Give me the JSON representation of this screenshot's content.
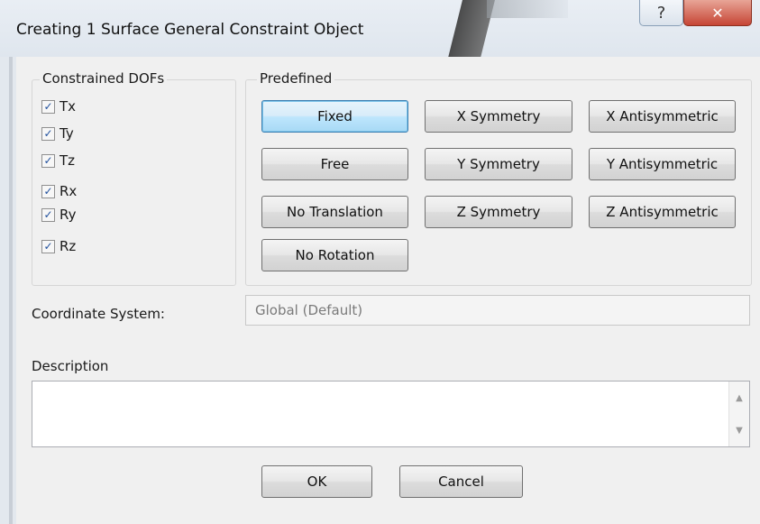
{
  "window": {
    "title": "Creating 1 Surface General Constraint Object",
    "help_glyph": "?",
    "close_glyph": "✕"
  },
  "constrained_dofs": {
    "legend": "Constrained DOFs",
    "items": [
      {
        "label": "Tx",
        "checked": true
      },
      {
        "label": "Ty",
        "checked": true
      },
      {
        "label": "Tz",
        "checked": true
      },
      {
        "label": "Rx",
        "checked": true
      },
      {
        "label": "Ry",
        "checked": true
      },
      {
        "label": "Rz",
        "checked": true
      }
    ]
  },
  "predefined": {
    "legend": "Predefined",
    "buttons": {
      "fixed": "Fixed",
      "free": "Free",
      "no_translation": "No Translation",
      "no_rotation": "No Rotation",
      "x_symmetry": "X Symmetry",
      "y_symmetry": "Y Symmetry",
      "z_symmetry": "Z Symmetry",
      "x_antisymmetric": "X Antisymmetric",
      "y_antisymmetric": "Y Antisymmetric",
      "z_antisymmetric": "Z Antisymmetric"
    }
  },
  "coordinate_system": {
    "label": "Coordinate System:",
    "value": "Global (Default)"
  },
  "description": {
    "label": "Description",
    "value": ""
  },
  "footer": {
    "ok_label": "OK",
    "cancel_label": "Cancel"
  },
  "colors": {
    "dialog_bg": "#f0f0f0",
    "default_button_accent": "#3c7fb1",
    "close_button": "#c64535",
    "checkmark": "#1f4f9c"
  }
}
